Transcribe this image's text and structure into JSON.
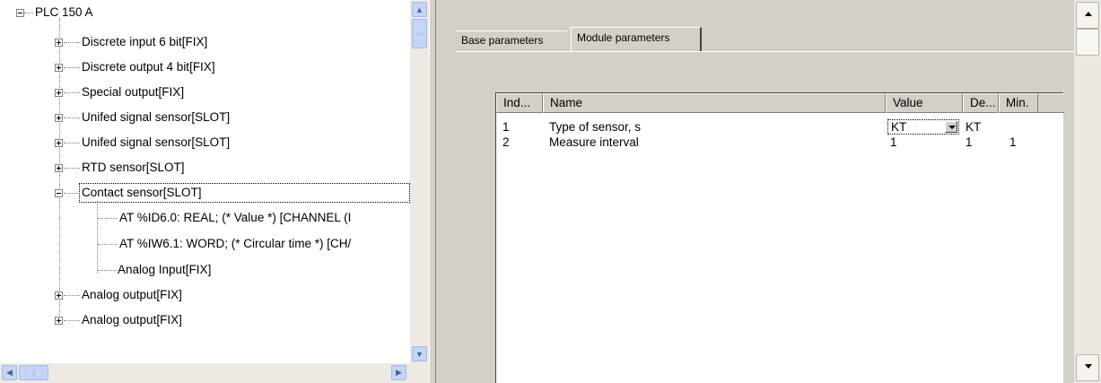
{
  "tree": {
    "root": "PLC 150 A",
    "items": [
      {
        "label": "Discrete input 6 bit[FIX]"
      },
      {
        "label": "Discrete output 4 bit[FIX]"
      },
      {
        "label": "Special output[FIX]"
      },
      {
        "label": "Unifed signal sensor[SLOT]"
      },
      {
        "label": "Unifed signal sensor[SLOT]"
      },
      {
        "label": "RTD sensor[SLOT]"
      },
      {
        "label": "Contact sensor[SLOT]",
        "children": [
          {
            "label": "AT %ID6.0: REAL; (* Value *) [CHANNEL (I"
          },
          {
            "label": "AT %IW6.1: WORD; (* Circular time *) [CH/"
          },
          {
            "label": "Analog Input[FIX]"
          }
        ]
      },
      {
        "label": "Analog output[FIX]"
      },
      {
        "label": "Analog output[FIX]"
      }
    ]
  },
  "tabs": [
    {
      "label": "Base parameters",
      "active": false
    },
    {
      "label": "Module parameters",
      "active": true
    }
  ],
  "grid": {
    "columns": [
      "Ind...",
      "Name",
      "Value",
      "De...",
      "Min."
    ],
    "rows": [
      {
        "index": "1",
        "name": "Type of sensor, s",
        "value": "KT",
        "default": "KT",
        "min": ""
      },
      {
        "index": "2",
        "name": "Measure interval",
        "value": "1",
        "default": "1",
        "min": "1"
      }
    ]
  }
}
